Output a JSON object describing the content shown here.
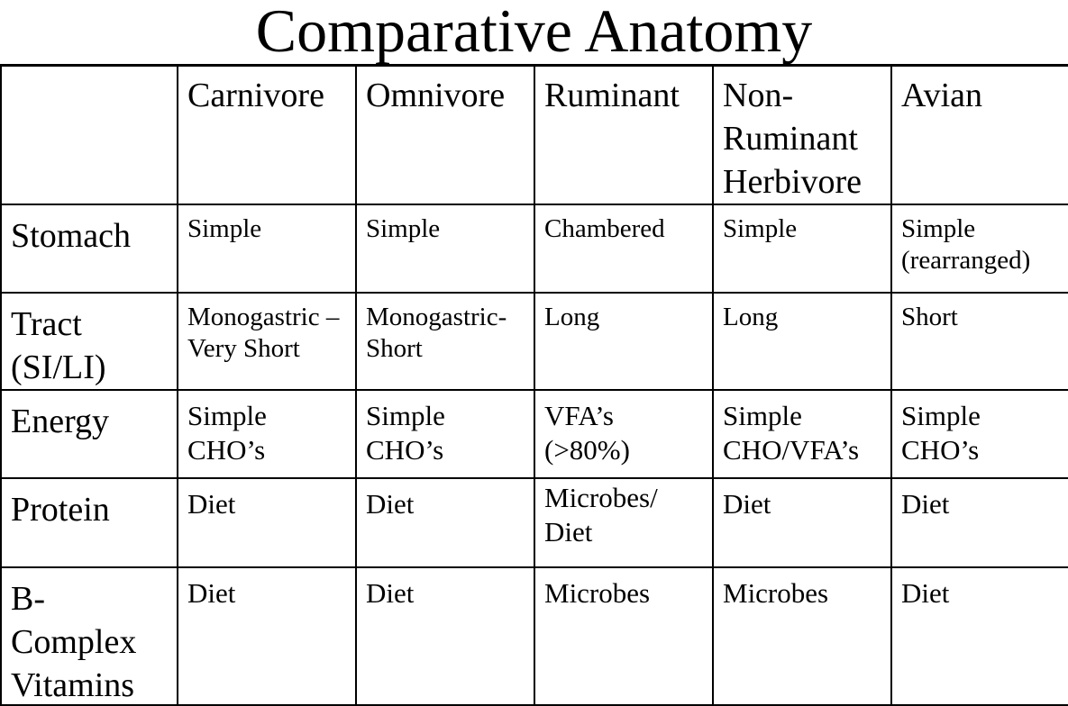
{
  "title": "Comparative Anatomy",
  "columns": [
    "",
    "Carnivore",
    "Omnivore",
    "Ruminant",
    "Non-\nRuminant\nHerbivore",
    "Avian"
  ],
  "rows": [
    {
      "label": "Stomach",
      "cells": [
        "Simple",
        "Simple",
        "Chambered",
        "Simple",
        "Simple\n(rearranged)"
      ]
    },
    {
      "label": "Tract\n(SI/LI)",
      "cells": [
        "Monogastric –\nVery Short",
        "Monogastric-\nShort",
        "Long",
        "Long",
        "Short"
      ]
    },
    {
      "label": "Energy",
      "cells": [
        "Simple\nCHO’s",
        "Simple\nCHO’s",
        "VFA’s\n(>80%)",
        "Simple\nCHO/VFA’s",
        "Simple\nCHO’s"
      ]
    },
    {
      "label": "Protein",
      "cells": [
        "Diet",
        "Diet",
        "Microbes/\nDiet",
        "Diet",
        "Diet"
      ]
    },
    {
      "label": "B-\nComplex\nVitamins",
      "cells": [
        "Diet",
        "Diet",
        "Microbes",
        "Microbes",
        "Diet"
      ]
    }
  ]
}
